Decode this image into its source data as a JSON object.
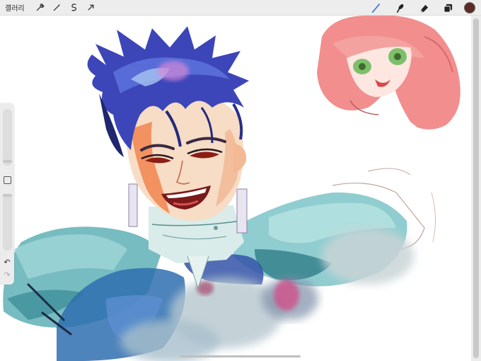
{
  "toolbar": {
    "gallery_label": "갤러리",
    "left_tools": [
      "wrench-icon",
      "magic-wand-icon",
      "selection-icon",
      "transform-arrow-icon"
    ],
    "right_tools": [
      "brush-icon",
      "smudge-icon",
      "eraser-icon",
      "layers-icon"
    ],
    "active_tool": "brush-icon",
    "active_color": "#5e2a26"
  },
  "colors": {
    "accent_blue": "#3a6fe0",
    "toolbar_bg": "#ededed"
  },
  "sidebar": {
    "tools": [
      "brush-size-slider",
      "modify-button",
      "opacity-slider",
      "undo-icon",
      "redo-icon"
    ]
  }
}
